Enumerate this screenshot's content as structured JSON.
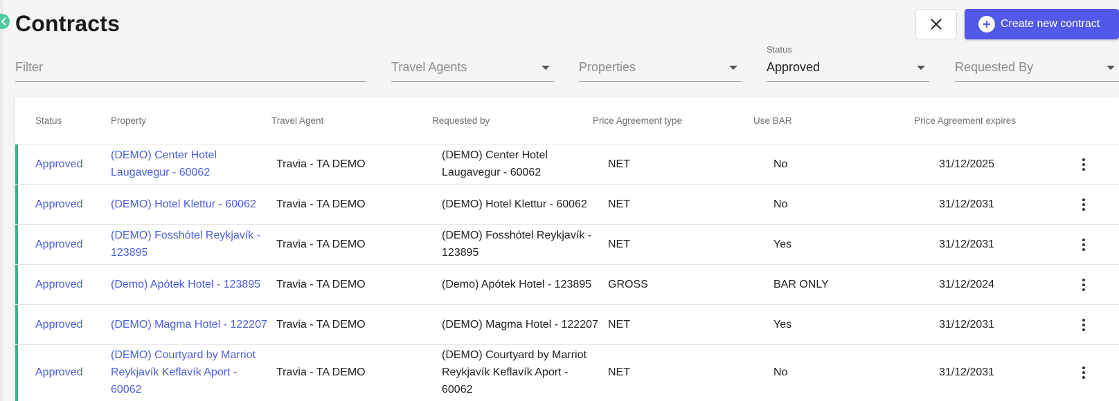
{
  "page": {
    "title": "Contracts"
  },
  "header": {
    "create_label": "Create new contract"
  },
  "filters": {
    "filter_placeholder": "Filter",
    "travel_agents_placeholder": "Travel Agents",
    "properties_placeholder": "Properties",
    "status_label": "Status",
    "status_value": "Approved",
    "requested_by_placeholder": "Requested By"
  },
  "table": {
    "headers": [
      "Status",
      "Property",
      "Travel Agent",
      "Requested by",
      "Price Agreement type",
      "Use BAR",
      "Price Agreement expires"
    ],
    "rows": [
      {
        "status": "Approved",
        "property": [
          "(DEMO) Center Hotel",
          "Laugavegur - 60062"
        ],
        "agent": "Travia - TA DEMO",
        "requested": [
          "(DEMO) Center Hotel",
          "Laugavegur - 60062"
        ],
        "type": "NET",
        "bar": "No",
        "expires": "31/12/2025"
      },
      {
        "status": "Approved",
        "property": [
          "(DEMO) Hotel Klettur - 60062"
        ],
        "agent": "Travia - TA DEMO",
        "requested": [
          "(DEMO) Hotel Klettur - 60062"
        ],
        "type": "NET",
        "bar": "No",
        "expires": "31/12/2031"
      },
      {
        "status": "Approved",
        "property": [
          "(DEMO) Fosshótel Reykjavík -",
          "123895"
        ],
        "agent": "Travia - TA DEMO",
        "requested": [
          "(DEMO) Fosshótel Reykjavík -",
          "123895"
        ],
        "type": "NET",
        "bar": "Yes",
        "expires": "31/12/2031"
      },
      {
        "status": "Approved",
        "property": [
          "(Demo) Apótek Hotel - 123895"
        ],
        "agent": "Travia - TA DEMO",
        "requested": [
          "(Demo) Apótek Hotel - 123895"
        ],
        "type": "GROSS",
        "bar": "BAR ONLY",
        "expires": "31/12/2024"
      },
      {
        "status": "Approved",
        "property": [
          "(DEMO) Magma Hotel - 122207"
        ],
        "agent": "Travia - TA DEMO",
        "requested": [
          "(DEMO) Magma Hotel - 122207"
        ],
        "type": "NET",
        "bar": "Yes",
        "expires": "31/12/2031"
      },
      {
        "status": "Approved",
        "property": [
          "(DEMO) Courtyard by Marriot",
          "Reykjavík Keflavík Aport -",
          "60062"
        ],
        "agent": "Travia - TA DEMO",
        "requested": [
          "(DEMO) Courtyard by Marriot",
          "Reykjavík Keflavík Aport -",
          "60062"
        ],
        "type": "NET",
        "bar": "No",
        "expires": "31/12/2031"
      }
    ]
  },
  "colors": {
    "accent": "#5259e8",
    "link": "#4a5fe0",
    "row_bar": "#3fae90",
    "back_badge": "#4cc9a0"
  },
  "icons": {
    "back": "chevron-left-icon",
    "close": "close-icon",
    "create": "plus-circle-icon",
    "dropdown": "caret-down-icon",
    "row_menu": "more-vert-icon"
  }
}
